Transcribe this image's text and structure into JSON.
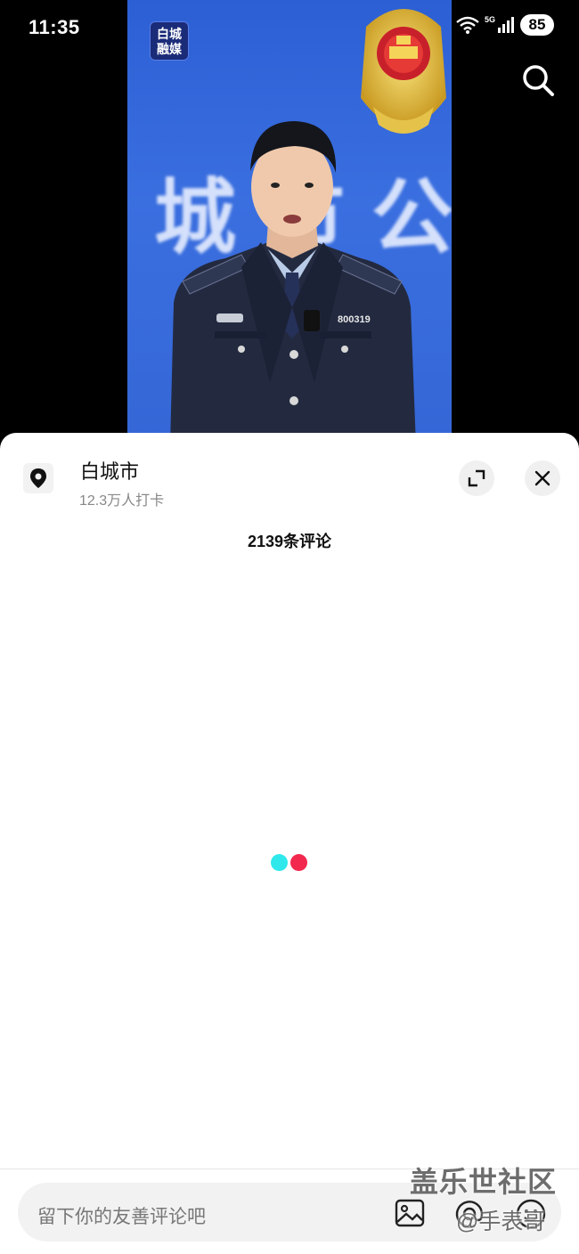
{
  "status_bar": {
    "time": "11:35",
    "network_label": "5G",
    "battery": "85"
  },
  "video": {
    "channel_logo_line1": "白城",
    "channel_logo_line2": "融媒",
    "wall_text": "城市公",
    "badge_number": "800319"
  },
  "location": {
    "name": "白城市",
    "checkins": "12.3万人打卡"
  },
  "comments": {
    "count_label": "2139条评论"
  },
  "input": {
    "placeholder": "留下你的友善评论吧"
  },
  "watermark": {
    "line1": "盖乐世社区",
    "line2": "@手表哥"
  },
  "icons": [
    "search-icon",
    "location-pin-icon",
    "expand-icon",
    "close-icon",
    "image-icon",
    "at-icon",
    "emoji-icon",
    "wifi-icon",
    "signal-icon"
  ],
  "colors": {
    "loading_cyan": "#2ee8ec",
    "loading_red": "#f2284e",
    "video_background": "#3566d6"
  }
}
